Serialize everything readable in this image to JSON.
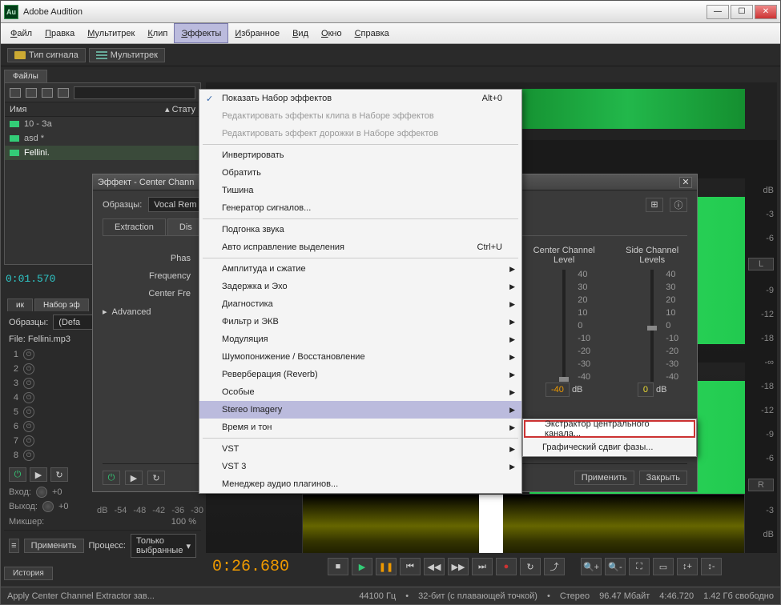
{
  "window": {
    "title": "Adobe Audition",
    "app_icon_text": "Au"
  },
  "win_buttons": {
    "min": "—",
    "max": "☐",
    "close": "✕"
  },
  "menubar": [
    {
      "label": "Файл",
      "underline": 0
    },
    {
      "label": "Правка",
      "underline": 0
    },
    {
      "label": "Мультитрек",
      "underline": 0
    },
    {
      "label": "Клип",
      "underline": 0
    },
    {
      "label": "Эффекты",
      "underline": 0,
      "active": true
    },
    {
      "label": "Избранное",
      "underline": 0
    },
    {
      "label": "Вид",
      "underline": 0
    },
    {
      "label": "Окно",
      "underline": 0
    },
    {
      "label": "Справка",
      "underline": 0
    }
  ],
  "toolbar": {
    "signal_type": "Тип сигнала",
    "multitrack": "Мультитрек"
  },
  "files_panel": {
    "tab": "Файлы",
    "search_placeholder": "",
    "header_name": "Имя",
    "header_status": "Стату",
    "rows": [
      {
        "label": "10 - За"
      },
      {
        "label": "asd *"
      },
      {
        "label": "Fellini."
      }
    ]
  },
  "time_small": "0:01.570",
  "rack": {
    "tabs": [
      "ик",
      "Набор эф"
    ],
    "presets_label": "Образцы:",
    "preset_value": "(Defa",
    "file_label": "File: Fellini.mp3",
    "tracks": [
      1,
      2,
      3,
      4,
      5,
      6,
      7,
      8
    ],
    "input_label": "Вход:",
    "input_value": "+0",
    "output_label": "Выход:",
    "output_value": "+0",
    "mixer_label": "Микшер:",
    "mixer_value": "100 %",
    "apply": "Применить",
    "process_label": "Процесс:",
    "process_value": "Только выбранные"
  },
  "fx_dialog": {
    "title": "Эффект - Center Chann",
    "presets_label": "Образцы:",
    "preset_value": "Vocal Rem",
    "tabs": [
      "Extraction",
      "Dis"
    ],
    "phase_label": "Phas",
    "freq_label": "Frequency",
    "centerfreq_label": "Center Fre",
    "advanced": "Advanced",
    "sliders": {
      "center": {
        "label": "Center Channel Level",
        "value": "-40",
        "unit": "dB"
      },
      "side": {
        "label": "Side Channel Levels",
        "value": "0",
        "unit": "dB"
      },
      "ticks": [
        "40",
        "30",
        "20",
        "10",
        "0",
        "-10",
        "-20",
        "-30",
        "-40"
      ]
    },
    "apply": "Применить",
    "close": "Закрыть"
  },
  "effects_menu": [
    {
      "label": "Показать Набор эффектов",
      "shortcut": "Alt+0",
      "check": true
    },
    {
      "label": "Редактировать эффекты клипа в Наборе эффектов",
      "disabled": true
    },
    {
      "label": "Редактировать эффект дорожки в Наборе эффектов",
      "disabled": true
    },
    {
      "sep": true
    },
    {
      "label": "Инвертировать"
    },
    {
      "label": "Обратить"
    },
    {
      "label": "Тишина"
    },
    {
      "label": "Генератор сигналов..."
    },
    {
      "sep": true
    },
    {
      "label": "Подгонка звука"
    },
    {
      "label": "Авто исправление выделения",
      "shortcut": "Ctrl+U"
    },
    {
      "sep": true
    },
    {
      "label": "Амплитуда и сжатие",
      "arrow": true
    },
    {
      "label": "Задержка и Эхо",
      "arrow": true
    },
    {
      "label": "Диагностика",
      "arrow": true
    },
    {
      "label": "Фильтр и ЭКВ",
      "arrow": true
    },
    {
      "label": "Модуляция",
      "arrow": true
    },
    {
      "label": "Шумопонижение / Восстановление",
      "arrow": true
    },
    {
      "label": "Реверберация (Reverb)",
      "arrow": true
    },
    {
      "label": "Особые",
      "arrow": true
    },
    {
      "label": "Stereo Imagery",
      "arrow": true,
      "hover": true
    },
    {
      "label": "Время и тон",
      "arrow": true
    },
    {
      "sep": true
    },
    {
      "label": "VST",
      "arrow": true
    },
    {
      "label": "VST 3",
      "arrow": true
    },
    {
      "label": "Менеджер аудио плагинов..."
    }
  ],
  "submenu": [
    {
      "label": "Экстрактор центрального канала...",
      "highlight": true
    },
    {
      "label": "Графический сдвиг фазы..."
    }
  ],
  "db_scale": {
    "values": [
      "dB",
      "-3",
      "-6",
      "-9",
      "-12",
      "-18",
      "-∞",
      "-18",
      "-12",
      "-9",
      "-6",
      "-3",
      "dB"
    ],
    "L": "L",
    "R": "R"
  },
  "transport": {
    "time": "0:26.680",
    "buttons": [
      "stop",
      "play",
      "pause",
      "skip-start",
      "rewind",
      "forward",
      "skip-end",
      "record",
      "loop",
      "return"
    ],
    "zoom": [
      "zoom-in",
      "zoom-out",
      "zoom-full",
      "zoom-sel",
      "zoom-in-v",
      "zoom-out-v"
    ]
  },
  "meter_scale": [
    "dB",
    "-54",
    "-48",
    "-42",
    "-36",
    "-30"
  ],
  "statusbar": {
    "action": "Apply Center Channel Extractor зав...",
    "sample": "44100 Гц",
    "bit": "32-бит (с плавающей точкой)",
    "channels": "Стерео",
    "size": "96.47 Мбайт",
    "duration": "4:46.720",
    "disk": "1.42 Гб свободно"
  },
  "history_tab": "История"
}
